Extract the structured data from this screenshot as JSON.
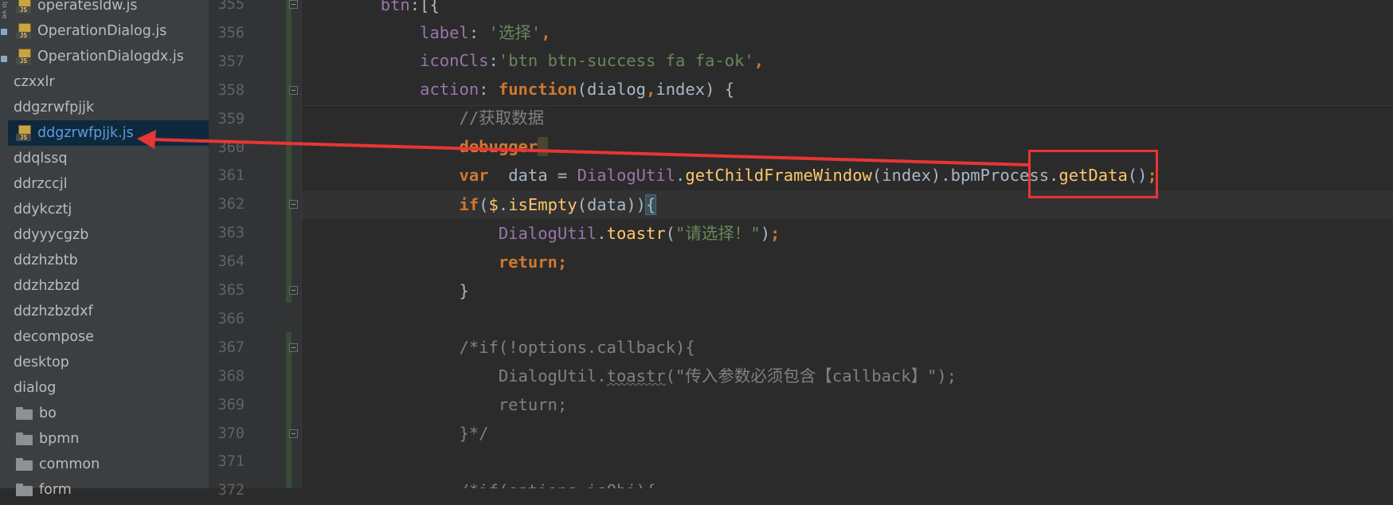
{
  "project_tree": {
    "strip_text": "lo ve",
    "items": [
      {
        "label": "operatesldw.js",
        "icon": "js-file-icon",
        "indent": 1
      },
      {
        "label": "OperationDialog.js",
        "icon": "js-file-icon",
        "indent": 1
      },
      {
        "label": "OperationDialogdx.js",
        "icon": "js-file-icon",
        "indent": 1
      },
      {
        "label": "czxxlr",
        "icon": "",
        "indent": 0
      },
      {
        "label": "ddgzrwfpjjk",
        "icon": "",
        "indent": 0
      },
      {
        "label": "ddgzrwfpjjk.js",
        "icon": "js-file-icon",
        "indent": 1,
        "selected": true
      },
      {
        "label": "ddqlssq",
        "icon": "",
        "indent": 0
      },
      {
        "label": "ddrzccjl",
        "icon": "",
        "indent": 0
      },
      {
        "label": "ddykcztj",
        "icon": "",
        "indent": 0
      },
      {
        "label": "ddyyycgzb",
        "icon": "",
        "indent": 0
      },
      {
        "label": "ddzhzbtb",
        "icon": "",
        "indent": 0
      },
      {
        "label": "ddzhzbzd",
        "icon": "",
        "indent": 0
      },
      {
        "label": "ddzhzbzdxf",
        "icon": "",
        "indent": 0
      },
      {
        "label": "decompose",
        "icon": "",
        "indent": 0
      },
      {
        "label": "desktop",
        "icon": "",
        "indent": 0
      },
      {
        "label": "dialog",
        "icon": "",
        "indent": 0
      },
      {
        "label": "bo",
        "icon": "folder-icon",
        "indent": 1
      },
      {
        "label": "bpmn",
        "icon": "folder-icon",
        "indent": 1
      },
      {
        "label": "common",
        "icon": "folder-icon",
        "indent": 1
      },
      {
        "label": "form",
        "icon": "folder-icon",
        "indent": 1
      }
    ]
  },
  "line_numbers": [
    "355",
    "356",
    "357",
    "358",
    "359",
    "360",
    "361",
    "362",
    "363",
    "364",
    "365",
    "366",
    "367",
    "368",
    "369",
    "370",
    "371",
    "372"
  ],
  "code": {
    "l355": {
      "a": "        ",
      "btn": "btn",
      "rest": ":[{"
    },
    "l356": {
      "indent": "            ",
      "key": "label",
      "colon": ": ",
      "val": "'选择'",
      "comma": ","
    },
    "l357": {
      "indent": "            ",
      "key": "iconCls",
      "colon": ":",
      "val": "'btn btn-success fa fa-ok'",
      "comma": ","
    },
    "l358": {
      "indent": "            ",
      "key": "action",
      "colon": ": ",
      "kw": "function",
      "p1": "(dialog",
      "comma": ",",
      "p2": "index) {"
    },
    "l359": {
      "indent": "                ",
      "comment": "//获取数据"
    },
    "l360": {
      "indent": "                ",
      "kw": "debugger",
      "after": " "
    },
    "l361": {
      "indent": "                ",
      "kw": "var",
      "sp": "  data = ",
      "obj": "DialogUtil",
      "dot1": ".",
      "fn1": "getChildFrameWindow",
      "args": "(index)",
      "dot2": ".",
      "prop": "bpmProcess",
      "dot3": ".",
      "fn2": "getData",
      "end": "()",
      "semi": ";"
    },
    "l362": {
      "indent": "                ",
      "kw": "if",
      "open": "(",
      "fn": "$",
      "dot": ".",
      "fn2": "isEmpty",
      "args": "(data))",
      "brace": "{"
    },
    "l363": {
      "indent": "                    ",
      "obj": "DialogUtil",
      "dot": ".",
      "fn": "toastr",
      "open": "(",
      "str": "\"请选择！\"",
      "close": ")",
      "semi": ";"
    },
    "l364": {
      "indent": "                    ",
      "kw": "return",
      "semi": ";"
    },
    "l365": {
      "indent": "                ",
      "text": "}"
    },
    "l367": {
      "indent": "                ",
      "comment": "/*if(!options.callback){"
    },
    "l368": {
      "indent": "                    ",
      "a": "DialogUtil.",
      "b": "toastr",
      "c": "(\"传入参数必须包含【callback】\");"
    },
    "l369": {
      "indent": "                    ",
      "comment": "return;"
    },
    "l370": {
      "indent": "                ",
      "comment": "}*/"
    },
    "l372": {
      "indent": "                ",
      "comment": "/*if(options.isObj){"
    }
  },
  "colors": {
    "background": "#2b2b2b",
    "keyword": "#cc7832",
    "function": "#ffc66d",
    "property": "#9876aa",
    "string": "#6a8759",
    "comment": "#808080",
    "annotation": "#e83535"
  }
}
